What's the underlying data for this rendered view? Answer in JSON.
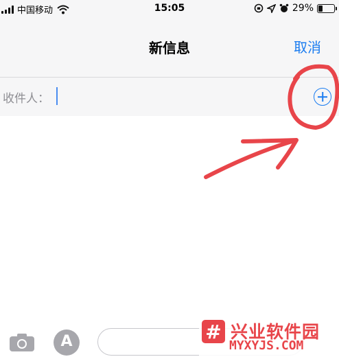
{
  "status_bar": {
    "carrier": "中国移动",
    "time": "15:05",
    "battery_percent": "29%",
    "battery_level": 0.29,
    "icons": [
      "signal-bars-icon",
      "wifi-icon",
      "lock-rotation-icon",
      "location-arrow-icon",
      "alarm-icon",
      "battery-icon"
    ]
  },
  "nav": {
    "title": "新信息",
    "cancel_label": "取消"
  },
  "recipient": {
    "label": "收件人：",
    "value": "",
    "add_icon": "plus-circle-icon"
  },
  "toolbar": {
    "camera_icon": "camera-icon",
    "appstore_icon": "app-store-icon",
    "appstore_glyph": "A"
  },
  "watermark": {
    "logo_glyph": "#",
    "title": "兴业软件园",
    "url": "MYXYJS.COM"
  },
  "colors": {
    "accent": "#1a7cf0",
    "annotation": "#e8454a",
    "bar_background": "#f6f6f7",
    "label_gray": "#8e8e93"
  }
}
